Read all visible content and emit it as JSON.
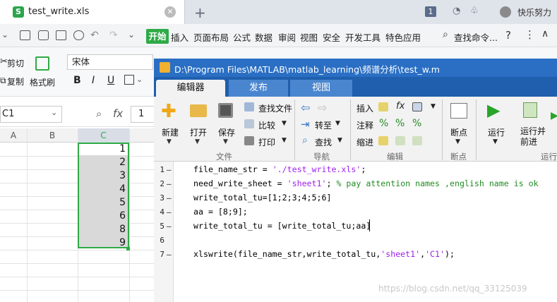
{
  "wps": {
    "tab_title": "test_write.xls",
    "tab_file_icon": "S",
    "new_tab_glyph": "+",
    "badge_count": "1",
    "user_name": "快乐努力",
    "menu": [
      "开始",
      "插入",
      "页面布局",
      "公式",
      "数据",
      "审阅",
      "视图",
      "安全",
      "开发工具",
      "特色应用"
    ],
    "search_label": "查找命令...",
    "help_glyph": "?",
    "ribbon": {
      "cut": "剪切",
      "copy": "复制",
      "format_painter": "格式刷",
      "font": "宋体",
      "bold": "B",
      "italic": "I",
      "underline": "U"
    },
    "name_box": "C1",
    "fx_label": "fx",
    "formula_value": "1",
    "columns": [
      "A",
      "B",
      "C"
    ],
    "c_values": [
      "1",
      "2",
      "3",
      "4",
      "5",
      "6",
      "8",
      "9"
    ],
    "colors": {
      "accent": "#2eaa46"
    }
  },
  "matlab": {
    "title": "D:\\Program Files\\MATLAB\\matlab_learning\\频谱分析\\test_w.m",
    "tabs": [
      "编辑器",
      "发布",
      "视图"
    ],
    "buttons": {
      "new": "新建",
      "open": "打开",
      "save": "保存",
      "find_files": "查找文件",
      "compare": "比较",
      "print": "打印",
      "goto": "转至",
      "find": "查找",
      "insert": "插入",
      "comment": "注释",
      "indent": "缩进",
      "breakpoint": "断点",
      "run": "运行",
      "run_advance": "运行并\n前进"
    },
    "sections": {
      "file": "文件",
      "nav": "导航",
      "edit": "编辑",
      "bp": "断点",
      "run": "运行"
    },
    "line_numbers": [
      "1",
      "2",
      "3",
      "4",
      "5",
      "6",
      "7"
    ],
    "code": {
      "l1_a": "file_name_str = ",
      "l1_s": "'./test_write.xls'",
      "l1_b": ";",
      "l2_a": "need_write_sheet = ",
      "l2_s": "'sheet1'",
      "l2_b": "; ",
      "l2_c": "% pay attention names ,english name is ok",
      "l3": "write_total_tu=[1;2;3;4;5;6]",
      "l4": "aa = [8;9];",
      "l5": "write_total_tu = [write_total_tu;aa]",
      "l7_a": "xlswrite(file_name_str,write_total_tu,",
      "l7_s1": "'sheet1'",
      "l7_b": ",",
      "l7_s2": "'C1'",
      "l7_c": ");"
    },
    "colors": {
      "title_bar": "#2a6fc4",
      "string": "#a020f0",
      "comment": "#228b22"
    }
  },
  "watermark": "https://blog.csdn.net/qq_33125039"
}
